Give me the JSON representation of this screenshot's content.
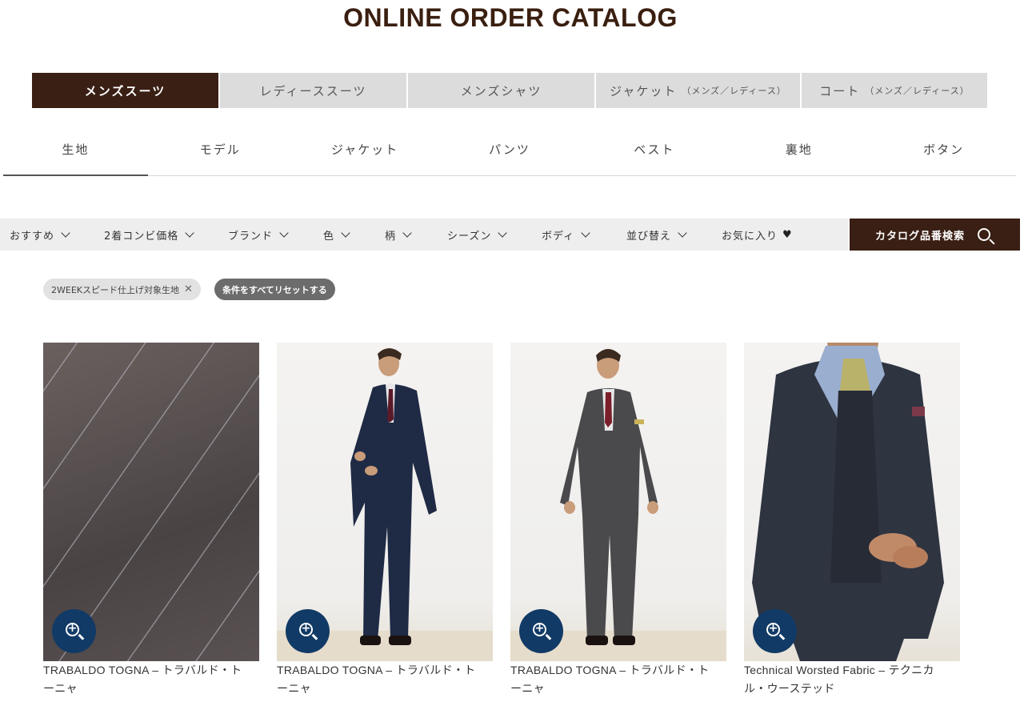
{
  "page_title": "ONLINE ORDER CATALOG",
  "category_tabs": [
    {
      "label": "メンズスーツ",
      "sub": "",
      "active": true
    },
    {
      "label": "レディーススーツ",
      "sub": "",
      "active": false
    },
    {
      "label": "メンズシャツ",
      "sub": "",
      "active": false
    },
    {
      "label": "ジャケット",
      "sub": "（メンズ／レディース）",
      "active": false
    },
    {
      "label": "コート",
      "sub": "（メンズ／レディース）",
      "active": false
    }
  ],
  "sub_tabs": [
    {
      "label": "生地",
      "active": true
    },
    {
      "label": "モデル",
      "active": false
    },
    {
      "label": "ジャケット",
      "active": false
    },
    {
      "label": "パンツ",
      "active": false
    },
    {
      "label": "ベスト",
      "active": false
    },
    {
      "label": "裏地",
      "active": false
    },
    {
      "label": "ボタン",
      "active": false
    }
  ],
  "filters": [
    {
      "label": "おすすめ"
    },
    {
      "label": "2着コンビ価格"
    },
    {
      "label": "ブランド"
    },
    {
      "label": "色"
    },
    {
      "label": "柄"
    },
    {
      "label": "シーズン"
    },
    {
      "label": "ボディ"
    },
    {
      "label": "並び替え"
    },
    {
      "label": "お気に入り"
    }
  ],
  "catalog_search_label": "カタログ品番検索",
  "active_filter_chip": "2WEEKスピード仕上げ対象生地",
  "reset_chip_label": "条件をすべてリセットする",
  "products": [
    {
      "name_line1": "TRABALDO TOGNA – トラバルド・ト",
      "name_line2": "ーニャ",
      "image": "fabric"
    },
    {
      "name_line1": "TRABALDO TOGNA – トラバルド・ト",
      "name_line2": "ーニャ",
      "image": "model-navy-suit"
    },
    {
      "name_line1": "TRABALDO TOGNA – トラバルド・ト",
      "name_line2": "ーニャ",
      "image": "model-grey-double-breasted"
    },
    {
      "name_line1": "Technical Worsted Fabric – テクニカ",
      "name_line2": "ル・ウーステッド",
      "image": "model-three-piece-closeup"
    }
  ],
  "colors": {
    "brand_dark": "#3a1f14",
    "zoom_button": "#113a66",
    "tab_inactive": "#dcdcdc"
  }
}
